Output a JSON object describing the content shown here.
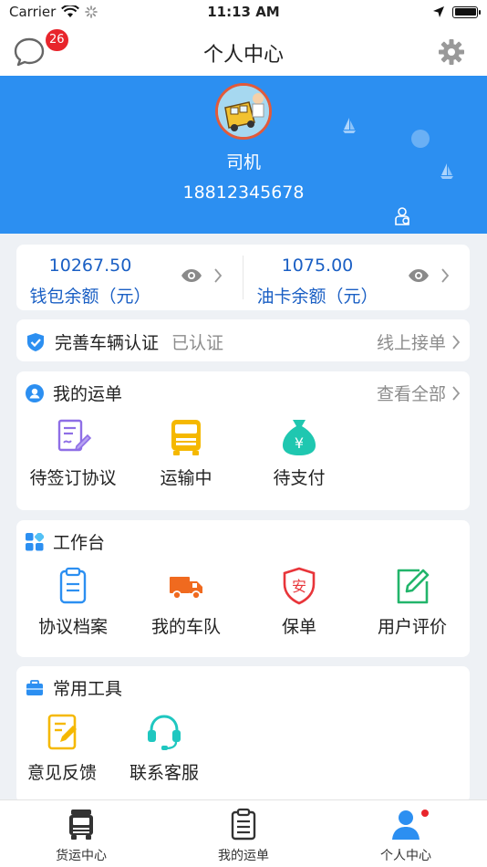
{
  "status_bar": {
    "carrier": "Carrier",
    "time": "11:13 AM"
  },
  "nav": {
    "title": "个人中心",
    "message_badge": "26"
  },
  "profile": {
    "name": "司机",
    "phone": "18812345678"
  },
  "balance": {
    "wallet": {
      "amount": "10267.50",
      "label": "钱包余额（元）"
    },
    "fuel_card": {
      "amount": "1075.00",
      "label": "油卡余额（元）"
    }
  },
  "certification": {
    "title": "完善车辆认证",
    "status": "已认证",
    "action": "线上接单"
  },
  "orders": {
    "title": "我的运单",
    "view_all": "查看全部",
    "items": [
      {
        "label": "待签订协议",
        "icon": "contract-sign-icon"
      },
      {
        "label": "运输中",
        "icon": "truck-front-icon"
      },
      {
        "label": "待支付",
        "icon": "money-bag-icon"
      }
    ]
  },
  "workbench": {
    "title": "工作台",
    "items": [
      {
        "label": "协议档案",
        "icon": "clipboard-icon"
      },
      {
        "label": "我的车队",
        "icon": "delivery-truck-icon"
      },
      {
        "label": "保单",
        "icon": "insurance-shield-icon"
      },
      {
        "label": "用户评价",
        "icon": "edit-review-icon"
      }
    ]
  },
  "tools": {
    "title": "常用工具",
    "items": [
      {
        "label": "意见反馈",
        "icon": "feedback-note-icon"
      },
      {
        "label": "联系客服",
        "icon": "headset-icon"
      }
    ]
  },
  "tabbar": {
    "items": [
      {
        "label": "货运中心",
        "icon": "truck-tab-icon"
      },
      {
        "label": "我的运单",
        "icon": "waybill-tab-icon"
      },
      {
        "label": "个人中心",
        "icon": "person-tab-icon",
        "active": true
      }
    ]
  },
  "colors": {
    "primary": "#2c8ff1",
    "amount_text": "#1a5fc4",
    "badge": "#e8252c",
    "background": "#eef1f5"
  }
}
